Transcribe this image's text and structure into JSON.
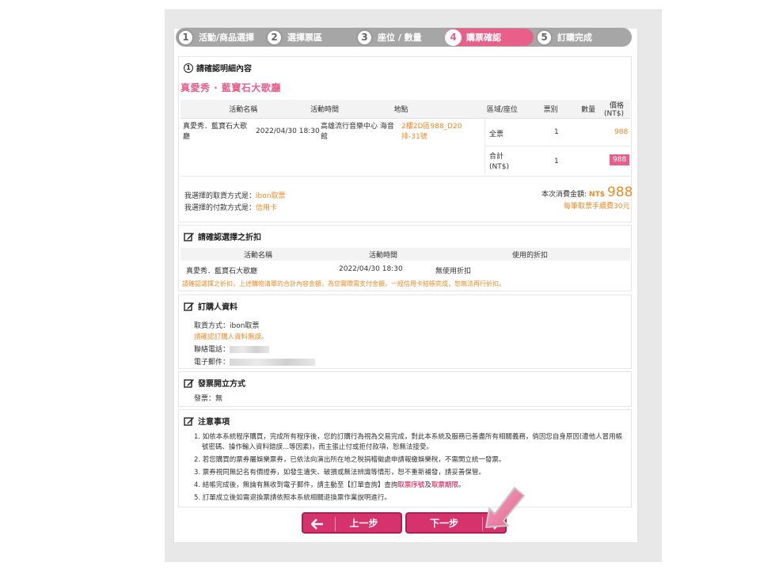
{
  "steps": [
    {
      "num": "1",
      "label": "活動/商品選擇"
    },
    {
      "num": "2",
      "label": "選擇票區"
    },
    {
      "num": "3",
      "label": "座位 / 數量"
    },
    {
      "num": "4",
      "label": "購票確認"
    },
    {
      "num": "5",
      "label": "訂購完成"
    }
  ],
  "confirm": {
    "title": "請確認明細內容",
    "event_title": "真愛秀 · 藍寶石大歌廳",
    "headers": [
      "活動名稱",
      "活動時間",
      "地點",
      "區域/座位",
      "票別",
      "數量",
      "價格(NT$)"
    ],
    "row": {
      "name": "真愛秀．藍寶石大歌廳",
      "time": "2022/04/30 18:30",
      "venue": "高雄流行音樂中心 海音館",
      "seat": "2樓2D區988_D20排-31號",
      "ticket_type": "全票",
      "qty": "1",
      "price": "988"
    },
    "subtotal": {
      "label": "合計(NT$)",
      "qty": "1",
      "price": "988"
    },
    "delivery_label": "我選擇的取貨方式是：",
    "delivery_value": "ibon取票",
    "payment_label": "我選擇的付款方式是：",
    "payment_value": "信用卡",
    "total_label": "本次消費金額:",
    "total_currency": "NT$",
    "total_value": "988",
    "fee_note": "每筆取票手續費30元"
  },
  "discount": {
    "title": "請確認選擇之折扣",
    "headers": [
      "活動名稱",
      "活動時間",
      "使用的折扣"
    ],
    "row": {
      "name": "真愛秀．藍寶石大歌廳",
      "time": "2022/04/30 18:30",
      "discount": "無使用折扣"
    },
    "note": "請確認選擇之折扣，上述購物清單的合計內容金額，為您實際需支付金額，一經信用卡結帳完成，恕無法再行折扣。"
  },
  "buyer": {
    "title": "訂購人資料",
    "delivery": "取貨方式：ibon取票",
    "verify_note": "請確認訂購人資料無誤。",
    "phone_label": "聯絡電話：",
    "email_label": "電子郵件："
  },
  "invoice": {
    "title": "發票開立方式",
    "value": "發票：無"
  },
  "notes": {
    "title": "注意事項",
    "items": [
      "1. 如依本系統程序購買，完成所有程序後，您的訂購行為視為交易完成，對此本系統及服務已善盡所有相關義務，倘因您自身原因(遭他人冒用帳號密碼、操作輸入資料錯誤...等因素)，而主張止付或拒付款項，恕無法接受。",
      "2. 若您購買的票券屬娛樂票券，已依法向演出所在地之稅捐稽徵處申請報繳娛樂稅，不需開立統一發票。",
      "3. 票券視同無記名有價證券，如發生遺失、破損或無法辨識等情形，恕不重新補發，請妥善保管。"
    ],
    "item4_pre": "4. 結帳完成後，無論有無收到電子郵件，請主動至【訂單查詢】查詢",
    "item4_red1": "取票序號",
    "item4_mid": "及",
    "item4_red2": "取票期限",
    "item4_post": "。",
    "item5": "5. 訂單成立後如需退換票請依照本系統相關退換票作業說明進行。"
  },
  "buttons": {
    "prev": "上一步",
    "next": "下一步"
  },
  "colors": {
    "accent": "#e8608a",
    "orange": "#f08a24",
    "button": "#d6336c"
  }
}
